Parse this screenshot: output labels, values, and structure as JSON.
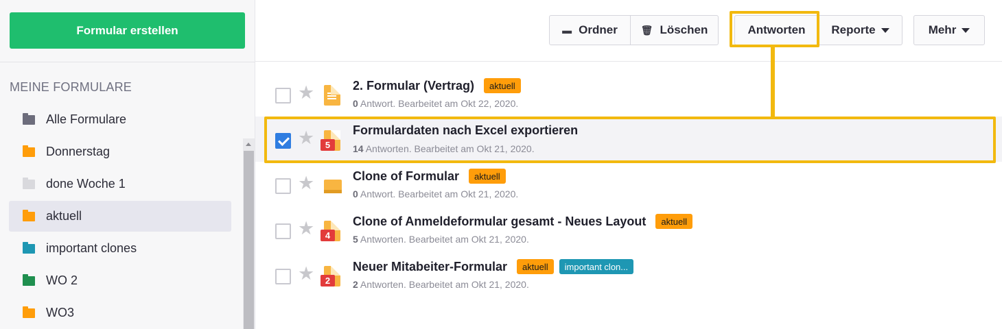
{
  "sidebar": {
    "create_button": "Formular erstellen",
    "section_title": "MEINE FORMULARE",
    "folders": [
      {
        "label": "Alle Formulare",
        "color": "#6d6d7c",
        "active": false
      },
      {
        "label": "Donnerstag",
        "color": "#ff9d0a",
        "active": false
      },
      {
        "label": "done Woche 1",
        "color": "#d9d9dd",
        "active": false
      },
      {
        "label": "aktuell",
        "color": "#ff9d0a",
        "active": true
      },
      {
        "label": "important clones",
        "color": "#1e97b3",
        "active": false
      },
      {
        "label": "WO 2",
        "color": "#1f8f4f",
        "active": false
      },
      {
        "label": "WO3",
        "color": "#ff9d0a",
        "active": false
      }
    ]
  },
  "toolbar": {
    "ordner": "Ordner",
    "loeschen": "Löschen",
    "antworten": "Antworten",
    "reporte": "Reporte",
    "mehr": "Mehr",
    "highlight_color": "#f2b90f"
  },
  "forms": [
    {
      "title": "2. Formular (Vertrag)",
      "tags": [
        "aktuell"
      ],
      "count": "0",
      "meta": " Antwort. Bearbeitet am Okt 22, 2020.",
      "checked": false,
      "badge": ""
    },
    {
      "title": "Formulardaten nach Excel exportieren",
      "tags": [],
      "count": "14",
      "meta": " Antworten. Bearbeitet am Okt 21, 2020.",
      "checked": true,
      "badge": "5"
    },
    {
      "title": "Clone of Formular",
      "tags": [
        "aktuell"
      ],
      "count": "0",
      "meta": " Antwort. Bearbeitet am Okt 21, 2020.",
      "checked": false,
      "badge": ""
    },
    {
      "title": "Clone of Anmeldeformular gesamt - Neues Layout",
      "tags": [
        "aktuell"
      ],
      "count": "5",
      "meta": " Antworten. Bearbeitet am Okt 21, 2020.",
      "checked": false,
      "badge": "4"
    },
    {
      "title": "Neuer Mitabeiter-Formular",
      "tags": [
        "aktuell",
        "important clon..."
      ],
      "count": "2",
      "meta": " Antworten. Bearbeitet am Okt 21, 2020.",
      "checked": false,
      "badge": "2"
    }
  ]
}
